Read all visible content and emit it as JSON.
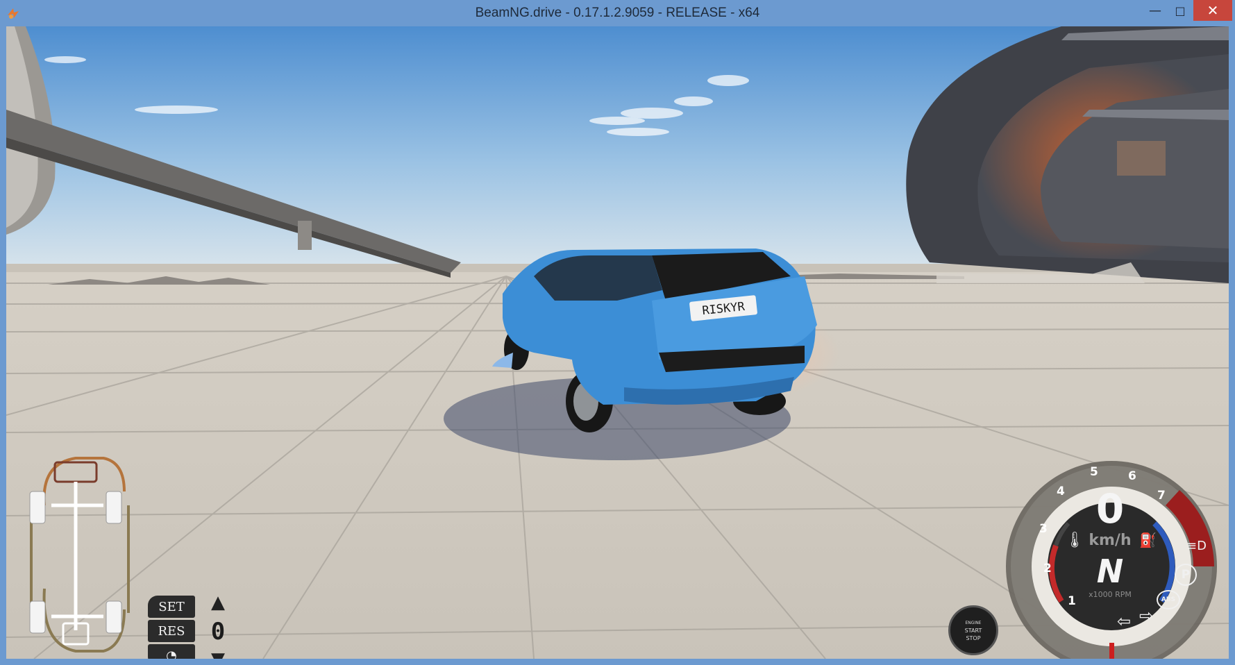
{
  "window": {
    "title": "BeamNG.drive - 0.17.1.2.9059 - RELEASE - x64",
    "minimize_label": "—",
    "maximize_label": "□",
    "close_label": "✕"
  },
  "scene": {
    "license_plate": "RISKYR"
  },
  "cruise_control": {
    "set_label": "SET",
    "res_label": "RES",
    "value": "0",
    "up_icon": "triangle-up-icon",
    "down_icon": "triangle-down-icon",
    "speedo_icon": "speedometer-icon"
  },
  "engine_button": {
    "line1": "ENGINE",
    "line2": "START",
    "line3": "STOP"
  },
  "gauge": {
    "speed": "0",
    "speed_unit": "km/h",
    "gear": "N",
    "rpm_label": "x1000 RPM",
    "rpm_ticks": [
      "1",
      "2",
      "3",
      "4",
      "5",
      "6",
      "7"
    ],
    "parking_label": "P",
    "abs_label": "ABS",
    "icons": [
      "temperature-icon",
      "fuel-icon",
      "headlight-icon",
      "parking-brake-icon",
      "abs-icon",
      "left-signal-icon",
      "right-signal-icon"
    ],
    "colors": {
      "redline": "#9b1e1e",
      "temp": "#c32a2a",
      "fuel": "#2e5bbd"
    }
  }
}
